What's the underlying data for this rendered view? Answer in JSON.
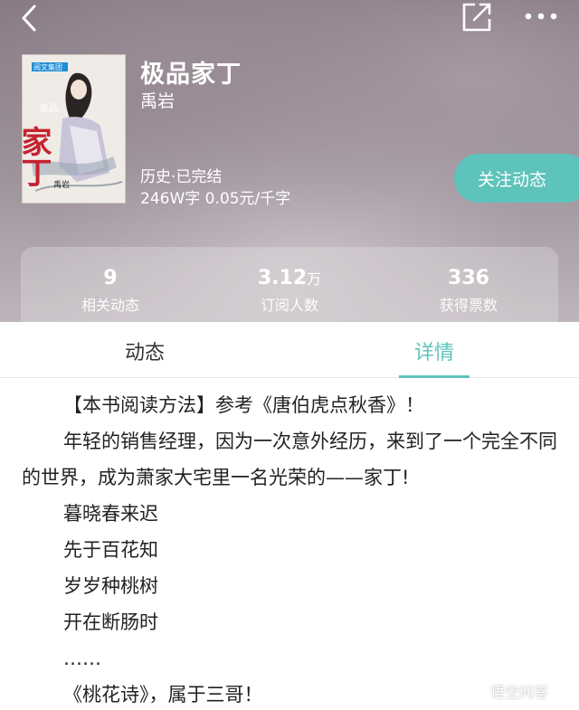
{
  "book": {
    "title": "极品家丁",
    "author": "禹岩",
    "genre": "历史·已完结",
    "meta": "246W字  0.05元/千字",
    "cover_text": {
      "publisher": "阅文集团",
      "big_title": "家丁",
      "small_title": "极品",
      "author": "禹岩"
    }
  },
  "header": {
    "follow_label": "关注动态"
  },
  "stats": [
    {
      "value": "9",
      "unit": "",
      "label": "相关动态"
    },
    {
      "value": "3.12",
      "unit": "万",
      "label": "订阅人数"
    },
    {
      "value": "336",
      "unit": "",
      "label": "获得票数"
    }
  ],
  "tabs": [
    {
      "label": "动态",
      "active": false
    },
    {
      "label": "详情",
      "active": true
    }
  ],
  "content": {
    "p1": "【本书阅读方法】参考《唐伯虎点秋香》！",
    "p2": "年轻的销售经理，因为一次意外经历，来到了一个完全不同的世界，成为萧家大宅里一名光荣的——家丁!",
    "l1": "暮晓春来迟",
    "l2": "先于百花知",
    "l3": "岁岁种桃树",
    "l4": "开在断肠时",
    "l5": "……",
    "l6": "《桃花诗》，属于三哥！"
  },
  "watermark": {
    "text": "悟空问答"
  },
  "colors": {
    "accent": "#5ec3bb",
    "text": "#222222"
  }
}
